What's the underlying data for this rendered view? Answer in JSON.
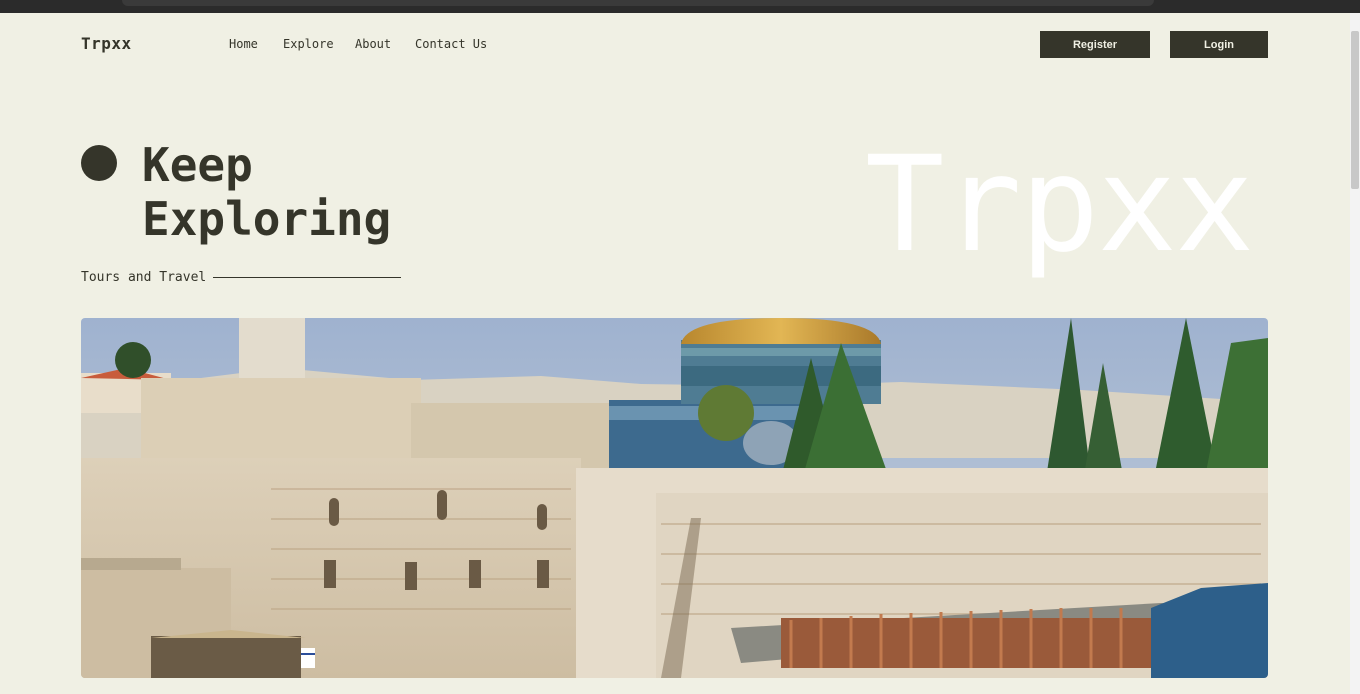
{
  "header": {
    "logo": "Trpxx",
    "nav": [
      "Home",
      "Explore",
      "About",
      "Contact Us"
    ],
    "register_label": "Register",
    "login_label": "Login"
  },
  "hero": {
    "headline_line1": "Keep",
    "headline_line2": "Exploring",
    "tagline": "Tours and Travel",
    "brand_watermark": "Trpxx"
  },
  "colors": {
    "background": "#f0f0e4",
    "dark": "#35352a",
    "watermark": "#ffffff"
  }
}
